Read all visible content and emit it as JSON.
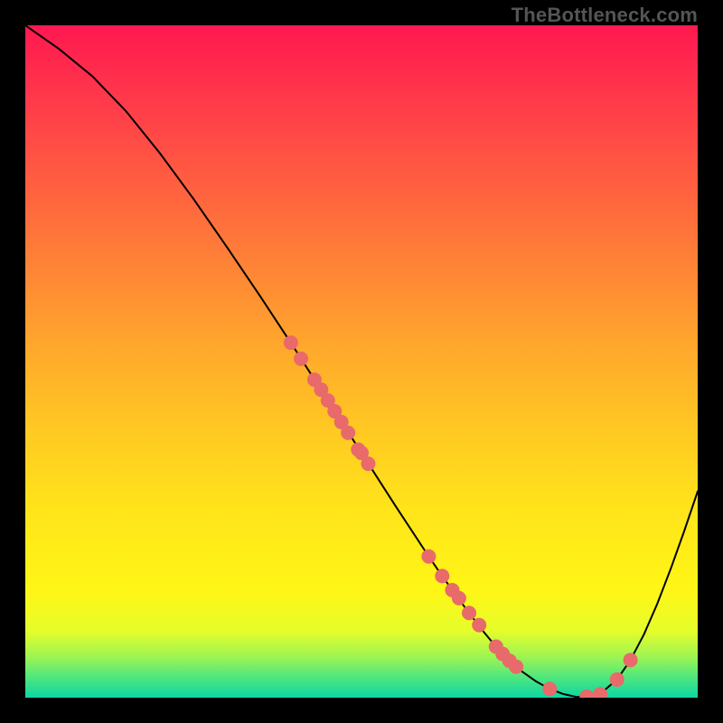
{
  "watermark": "TheBottleneck.com",
  "chart_data": {
    "type": "line",
    "title": "",
    "xlabel": "",
    "ylabel": "",
    "xlim": [
      0,
      100
    ],
    "ylim": [
      0,
      100
    ],
    "curve": {
      "x": [
        0,
        5,
        10,
        15,
        20,
        25,
        30,
        35,
        40,
        45,
        50,
        55,
        60,
        62,
        64,
        66,
        68,
        70,
        72,
        74,
        76,
        78,
        80,
        82,
        84,
        86,
        88,
        90,
        92,
        94,
        96,
        98,
        100
      ],
      "y": [
        100,
        96.5,
        92.4,
        87.2,
        81.0,
        74.2,
        67.0,
        59.6,
        52.0,
        44.2,
        36.4,
        28.6,
        21.0,
        18.1,
        15.3,
        12.6,
        10.0,
        7.6,
        5.5,
        3.8,
        2.4,
        1.3,
        0.55,
        0.1,
        0.32,
        1.0,
        2.7,
        5.6,
        9.4,
        14.0,
        19.2,
        24.8,
        30.7
      ]
    },
    "markers": {
      "x": [
        39.5,
        41.0,
        43.0,
        44.0,
        45.0,
        46.0,
        47.0,
        48.0,
        49.5,
        50.0,
        51.0,
        60.0,
        62.0,
        63.5,
        64.5,
        66.0,
        67.5,
        70.0,
        71.0,
        72.0,
        73.0,
        78.0,
        83.5,
        85.5,
        88.0,
        90.0
      ],
      "y": [
        52.8,
        50.4,
        47.3,
        45.8,
        44.2,
        42.6,
        41.0,
        39.4,
        36.9,
        36.4,
        34.8,
        21.0,
        18.1,
        16.0,
        14.8,
        12.6,
        10.8,
        7.6,
        6.5,
        5.5,
        4.6,
        1.3,
        0.15,
        0.5,
        2.7,
        5.6
      ],
      "color": "#e86a6a",
      "radius": 8
    }
  }
}
